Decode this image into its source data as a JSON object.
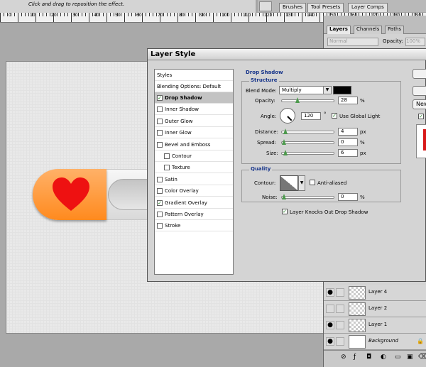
{
  "options_bar": {
    "hint": "Click and drag to reposition the effect."
  },
  "ruler": {
    "numbers": [
      "0",
      "10",
      "20",
      "30",
      "40",
      "50",
      "60",
      "70",
      "80",
      "90",
      "100",
      "110",
      "120",
      "130",
      "140",
      "150",
      "160",
      "170",
      "180",
      "190"
    ]
  },
  "panel_well_tabs": [
    "Brushes",
    "Tool Presets",
    "Layer Comps"
  ],
  "layers_panel": {
    "tabs": [
      "Layers",
      "Channels",
      "Paths"
    ],
    "blend_mode": "Normal",
    "opacity_label": "Opacity:",
    "opacity_value": "100%",
    "layers": [
      {
        "name": "Layer 4",
        "visible": true
      },
      {
        "name": "Layer 2",
        "visible": false
      },
      {
        "name": "Layer 1",
        "visible": true
      },
      {
        "name": "Background",
        "visible": true,
        "locked": true
      }
    ]
  },
  "dialog": {
    "title": "Layer Style",
    "styles_header": "Styles",
    "blending_options": "Blending Options: Default",
    "styles": [
      {
        "label": "Drop Shadow",
        "checked": true,
        "selected": true
      },
      {
        "label": "Inner Shadow",
        "checked": false
      },
      {
        "label": "Outer Glow",
        "checked": false
      },
      {
        "label": "Inner Glow",
        "checked": false
      },
      {
        "label": "Bevel and Emboss",
        "checked": false
      },
      {
        "label": "Contour",
        "checked": false,
        "sub": true
      },
      {
        "label": "Texture",
        "checked": false,
        "sub": true
      },
      {
        "label": "Satin",
        "checked": false
      },
      {
        "label": "Color Overlay",
        "checked": false
      },
      {
        "label": "Gradient Overlay",
        "checked": true
      },
      {
        "label": "Pattern Overlay",
        "checked": false
      },
      {
        "label": "Stroke",
        "checked": false
      }
    ],
    "drop_shadow": {
      "title": "Drop Shadow",
      "structure_title": "Structure",
      "blend_mode_label": "Blend Mode:",
      "blend_mode": "Multiply",
      "shadow_color": "#000000",
      "opacity_label": "Opacity:",
      "opacity": "28",
      "opacity_unit": "%",
      "angle_label": "Angle:",
      "angle": "120",
      "angle_unit": "°",
      "use_global_light": "Use Global Light",
      "distance_label": "Distance:",
      "distance": "4",
      "distance_unit": "px",
      "spread_label": "Spread:",
      "spread": "0",
      "spread_unit": "%",
      "size_label": "Size:",
      "size": "6",
      "size_unit": "px",
      "quality_title": "Quality",
      "contour_label": "Contour:",
      "anti_aliased": "Anti-aliased",
      "noise_label": "Noise:",
      "noise": "0",
      "noise_unit": "%",
      "knockout": "Layer Knocks Out Drop Shadow"
    },
    "buttons": {
      "new_partial": "New"
    }
  }
}
